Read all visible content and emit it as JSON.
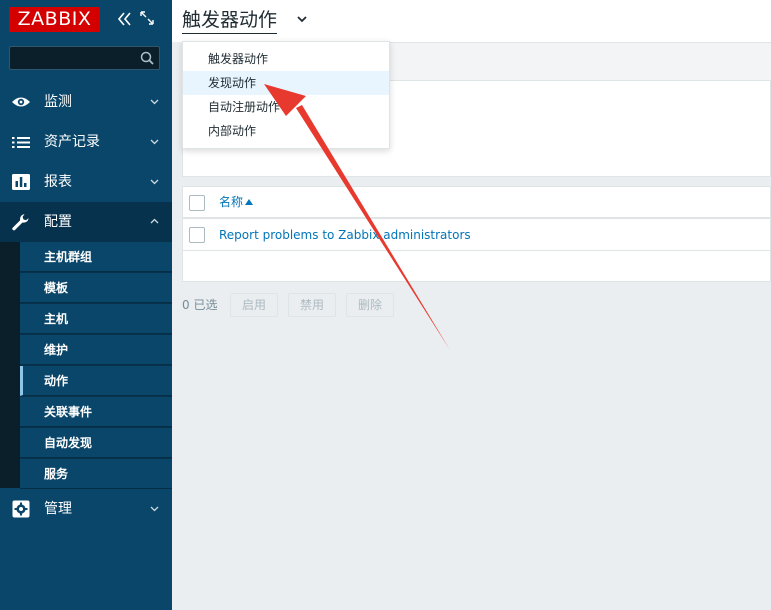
{
  "brand": {
    "logo_text": "ZABBIX",
    "logo_color": "#d40000"
  },
  "search": {
    "value": "",
    "placeholder": ""
  },
  "sidebar": {
    "sections": [
      {
        "label": "监测",
        "icon": "eye-icon"
      },
      {
        "label": "资产记录",
        "icon": "list-icon"
      },
      {
        "label": "报表",
        "icon": "bar-chart-icon"
      },
      {
        "label": "配置",
        "icon": "wrench-icon",
        "expanded": true
      },
      {
        "label": "管理",
        "icon": "gear-icon"
      }
    ],
    "config_items": [
      "主机群组",
      "模板",
      "主机",
      "维护",
      "动作",
      "关联事件",
      "自动发现",
      "服务"
    ],
    "selected_item": "动作"
  },
  "header": {
    "title": "触发器动作"
  },
  "dropdown": {
    "items": [
      "触发器动作",
      "发现动作",
      "自动注册动作",
      "内部动作"
    ],
    "hovered": "发现动作"
  },
  "table": {
    "column_name": "名称",
    "rows": [
      {
        "name": "Report problems to Zabbix administrators"
      }
    ]
  },
  "footer": {
    "selected_count": "0 已选",
    "buttons": {
      "enable": "启用",
      "disable": "禁用",
      "delete": "删除"
    }
  },
  "colors": {
    "sidebar": "#0a466a",
    "link": "#0275b8",
    "annotation_arrow": "#e8392f"
  }
}
